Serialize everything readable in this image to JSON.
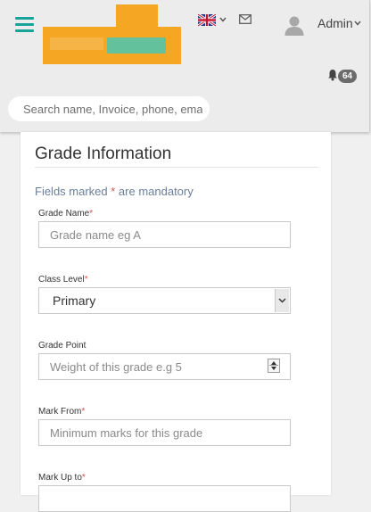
{
  "header": {
    "admin_label": "Admin",
    "notification_count": "64",
    "search_placeholder": "Search name, Invoice, phone, email"
  },
  "form": {
    "title": "Grade Information",
    "mandatory_note": {
      "prefix": "Fields marked ",
      "star": "*",
      "suffix": " are mandatory"
    },
    "fields": {
      "grade_name": {
        "label": "Grade Name",
        "required_mark": "*",
        "placeholder": "Grade name eg A"
      },
      "class_level": {
        "label": "Class Level",
        "required_mark": "*",
        "value": "Primary"
      },
      "grade_point": {
        "label": "Grade Point",
        "placeholder": "Weight of this grade e.g 5"
      },
      "mark_from": {
        "label": "Mark From",
        "required_mark": "*",
        "placeholder": "Minimum marks for this grade"
      },
      "mark_up_to": {
        "label": "Mark Up to",
        "required_mark": "*"
      }
    }
  },
  "colors": {
    "accent_teal": "#17a398",
    "logo_orange": "#f5a623",
    "required_red": "#d9534f"
  },
  "icons": [
    "menu-icon",
    "uk-flag-icon",
    "mail-icon",
    "user-icon",
    "bell-icon",
    "chevron-down-icon",
    "spinner-icon"
  ]
}
